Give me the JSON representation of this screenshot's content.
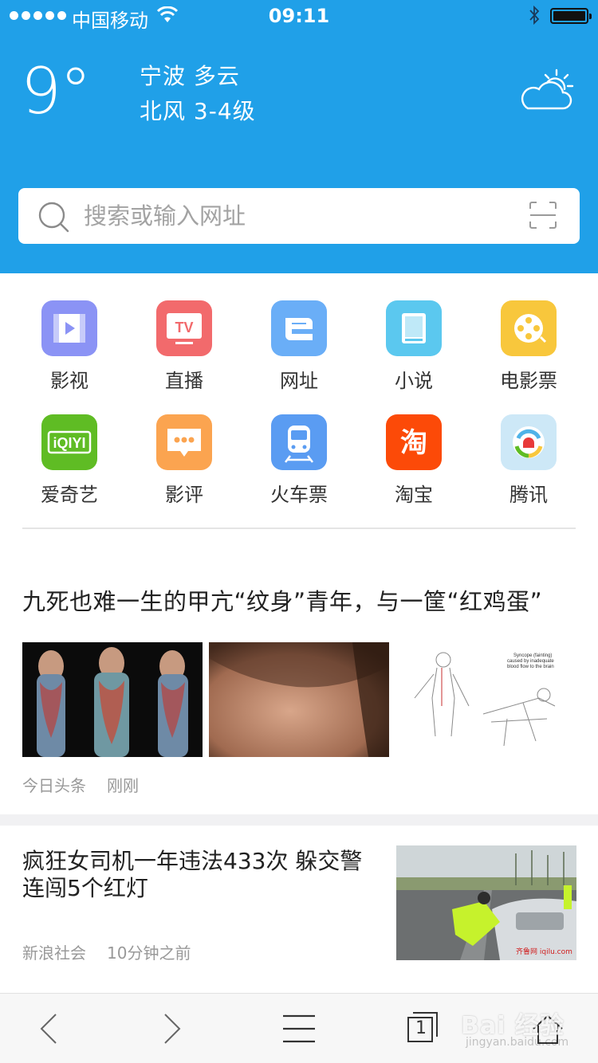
{
  "status_bar": {
    "carrier": "中国移动",
    "time": "09:11"
  },
  "weather": {
    "temperature": "9°",
    "city_condition": "宁波  多云",
    "wind": "北风 3-4级",
    "icon": "partly-cloudy-icon"
  },
  "search": {
    "placeholder": "搜索或输入网址",
    "scan_icon": "scan-icon"
  },
  "quick_links": [
    {
      "label": "影视",
      "icon": "video-icon",
      "color": "#8b93f5"
    },
    {
      "label": "直播",
      "icon": "tv-icon",
      "color": "#f26a6c"
    },
    {
      "label": "网址",
      "icon": "e-browser-icon",
      "color": "#6aaef7"
    },
    {
      "label": "小说",
      "icon": "book-icon",
      "color": "#5bc8ef"
    },
    {
      "label": "电影票",
      "icon": "film-reel-icon",
      "color": "#f8c73c"
    },
    {
      "label": "爱奇艺",
      "icon": "iqiyi-icon",
      "color": "#5fbc24"
    },
    {
      "label": "影评",
      "icon": "comment-icon",
      "color": "#fba450"
    },
    {
      "label": "火车票",
      "icon": "train-icon",
      "color": "#5a9cf2"
    },
    {
      "label": "淘宝",
      "icon": "taobao-icon",
      "color": "#fc4a08"
    },
    {
      "label": "腾讯",
      "icon": "tencent-icon",
      "color": "#cde8f7"
    }
  ],
  "news": [
    {
      "title": "九死也难一生的甲亢“纹身”青年，与一筐“红鸡蛋”",
      "source": "今日头条",
      "time": "刚刚",
      "image_caption": "Syncope (fainting) caused by inadequate blood flow to the brain"
    },
    {
      "title": "疯狂女司机一年违法433次 躲交警连闯5个红灯",
      "source": "新浪社会",
      "time": "10分钟之前"
    }
  ],
  "toolbar": {
    "back_icon": "chevron-left-icon",
    "forward_icon": "chevron-right-icon",
    "menu_icon": "hamburger-icon",
    "tab_count": "1",
    "home_icon": "home-icon"
  },
  "watermark": {
    "text": "Bai 经验",
    "sub": "jingyan.baidu.com"
  }
}
